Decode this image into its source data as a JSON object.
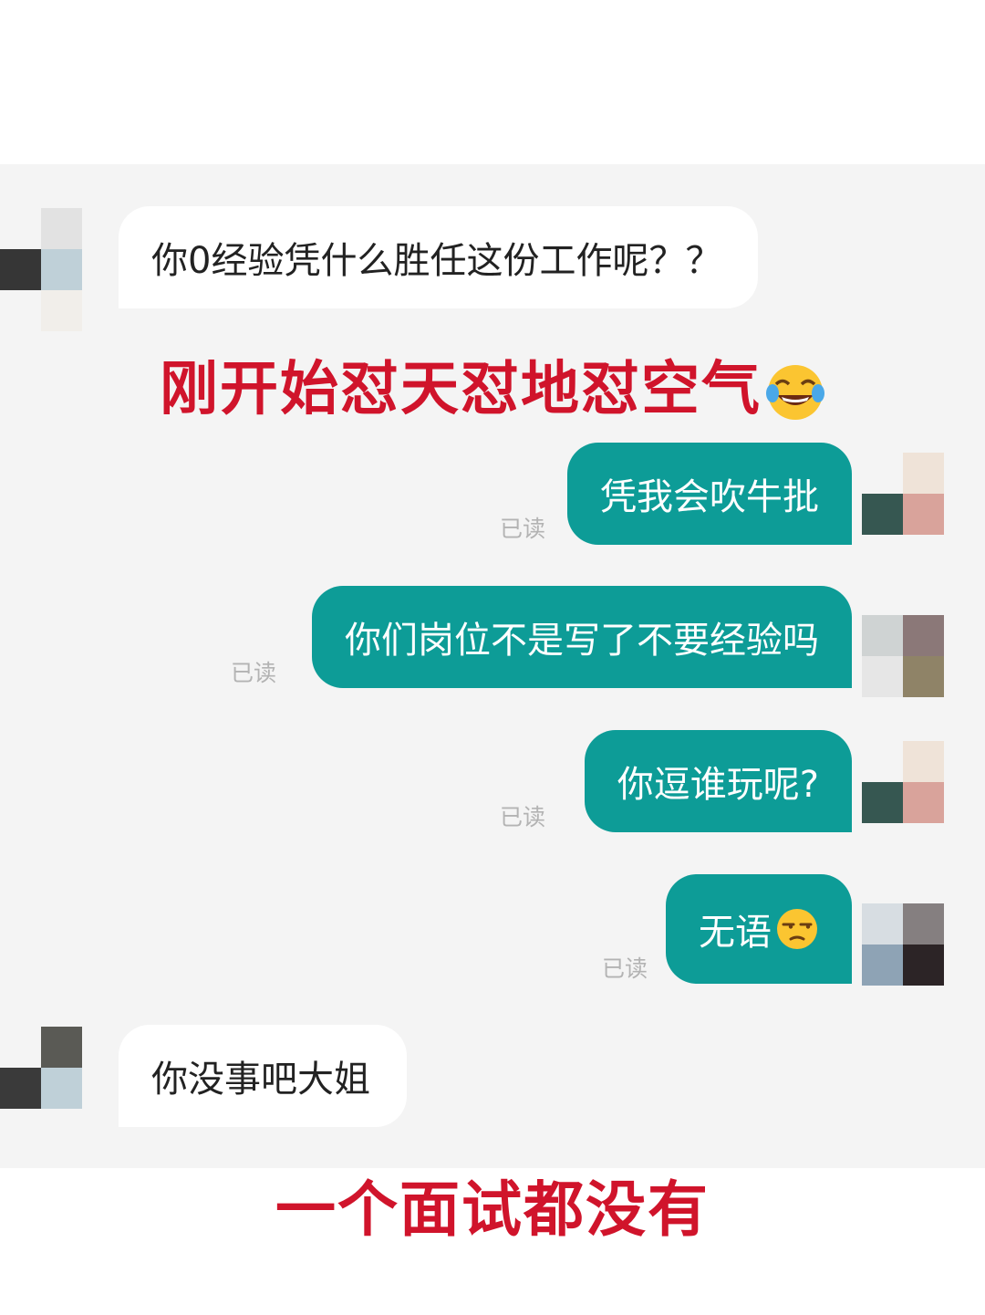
{
  "messages": [
    {
      "side": "left",
      "text": "你0经验凭什么胜任这份工作呢？？"
    },
    {
      "side": "right",
      "text": "凭我会吹牛批",
      "status": "已读"
    },
    {
      "side": "right",
      "text": "你们岗位不是写了不要经验吗",
      "status": "已读"
    },
    {
      "side": "right",
      "text": "你逗谁玩呢?",
      "status": "已读"
    },
    {
      "side": "right",
      "text": "无语",
      "emoji": "unamused-face-emoji",
      "status": "已读"
    },
    {
      "side": "left",
      "text": "你没事吧大姐"
    }
  ],
  "captions": {
    "top": "刚开始怼天怼地怼空气",
    "top_emoji": "face-with-tears-of-joy-emoji",
    "bottom": "一个面试都没有"
  },
  "colors": {
    "sent_bubble": "#0d9c97",
    "received_bubble": "#ffffff",
    "caption_red": "#d0142b",
    "chat_background": "#f4f4f4"
  }
}
